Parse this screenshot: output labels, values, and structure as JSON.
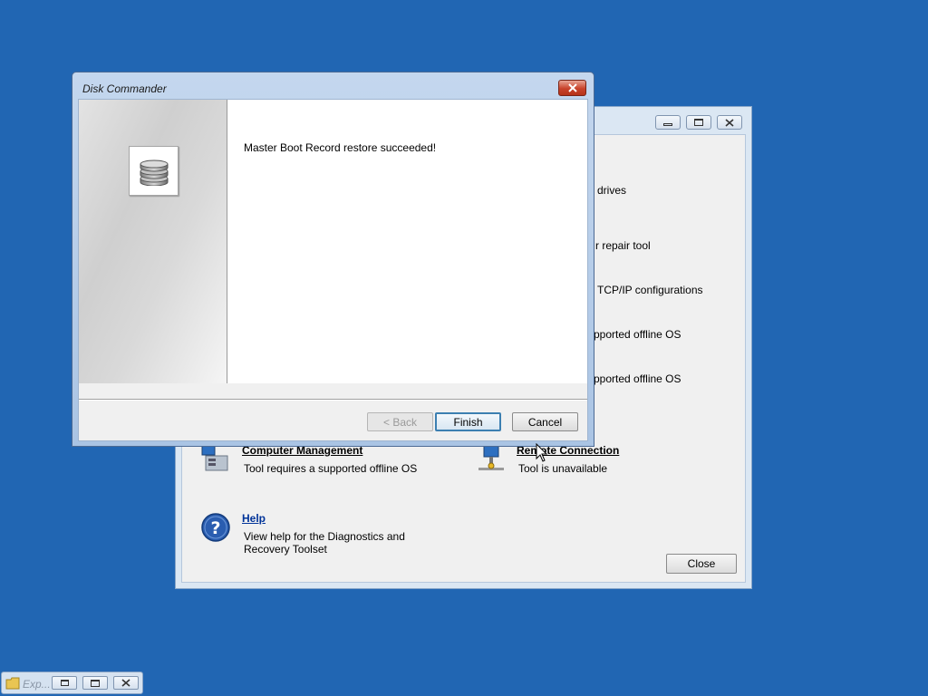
{
  "background_window": {
    "partial_items": [
      "drives",
      "r repair tool",
      "TCP/IP configurations",
      "pported offline OS",
      "pported offline OS"
    ],
    "computer_management": {
      "label": "Computer Management",
      "desc": "Tool requires a supported offline OS"
    },
    "remote_connection": {
      "label": "Remote Connection",
      "desc": "Tool is unavailable"
    },
    "help": {
      "label": "Help",
      "desc": "View help for the Diagnostics and Recovery Toolset"
    },
    "close_label": "Close"
  },
  "dialog": {
    "title": "Disk Commander",
    "message": "Master Boot Record restore succeeded!",
    "back_label": "< Back",
    "finish_label": "Finish",
    "cancel_label": "Cancel",
    "icon": "disk-stack-icon"
  },
  "taskbar": {
    "item_label": "Exp..."
  },
  "colors": {
    "desktop": "#2166b3",
    "link": "#003399",
    "close_red": "#c8432b"
  }
}
